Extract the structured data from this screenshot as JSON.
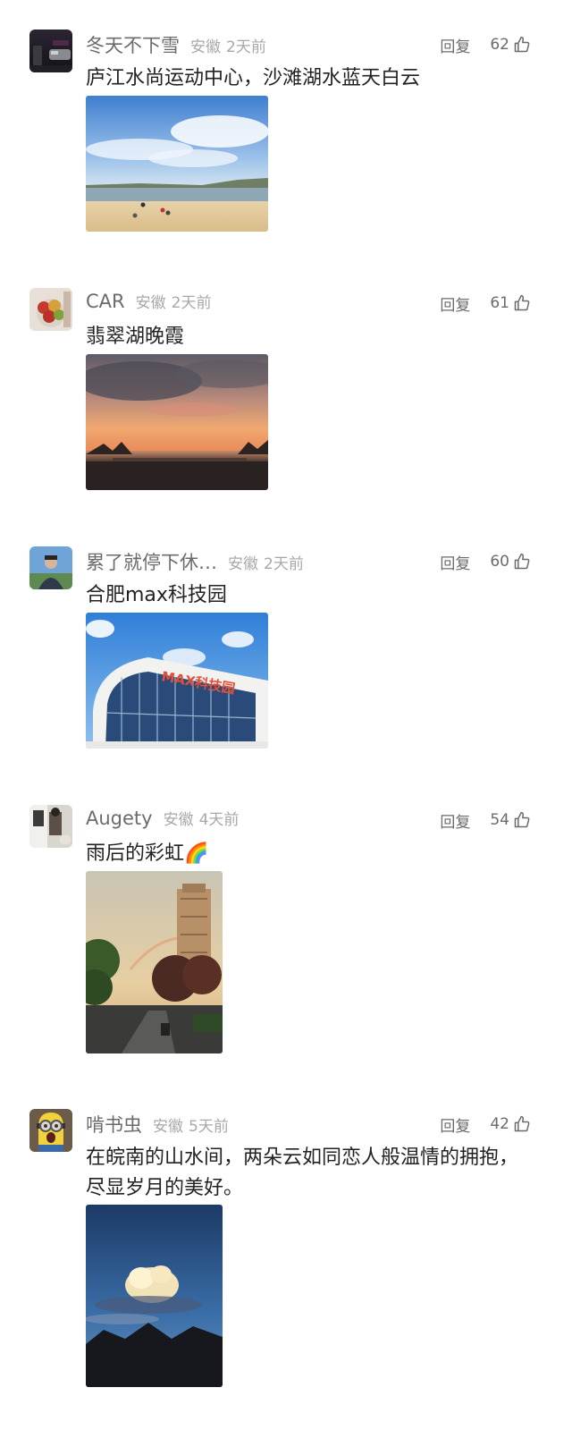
{
  "comments": [
    {
      "user": "冬天不下雪",
      "location": "安徽",
      "time": "2天前",
      "reply": "回复",
      "likes": "62",
      "text": "庐江水尚运动中心，沙滩湖水蓝天白云"
    },
    {
      "user": "CAR",
      "location": "安徽",
      "time": "2天前",
      "reply": "回复",
      "likes": "61",
      "text": "翡翠湖晚霞"
    },
    {
      "user": "累了就停下休…",
      "location": "安徽",
      "time": "2天前",
      "reply": "回复",
      "likes": "60",
      "text": "合肥max科技园",
      "photo_sign": "MAX科技园"
    },
    {
      "user": "Augety",
      "location": "安徽",
      "time": "4天前",
      "reply": "回复",
      "likes": "54",
      "text": "雨后的彩虹🌈"
    },
    {
      "user": "啃书虫",
      "location": "安徽",
      "time": "5天前",
      "reply": "回复",
      "likes": "42",
      "text": "在皖南的山水间，两朵云如同恋人般温情的拥抱，尽显岁月的美好。"
    }
  ],
  "colors": {
    "username": "#6b6b6b",
    "meta": "#a8a8a8",
    "text": "#222222"
  },
  "icons": {
    "like": "thumbs-up-icon"
  }
}
